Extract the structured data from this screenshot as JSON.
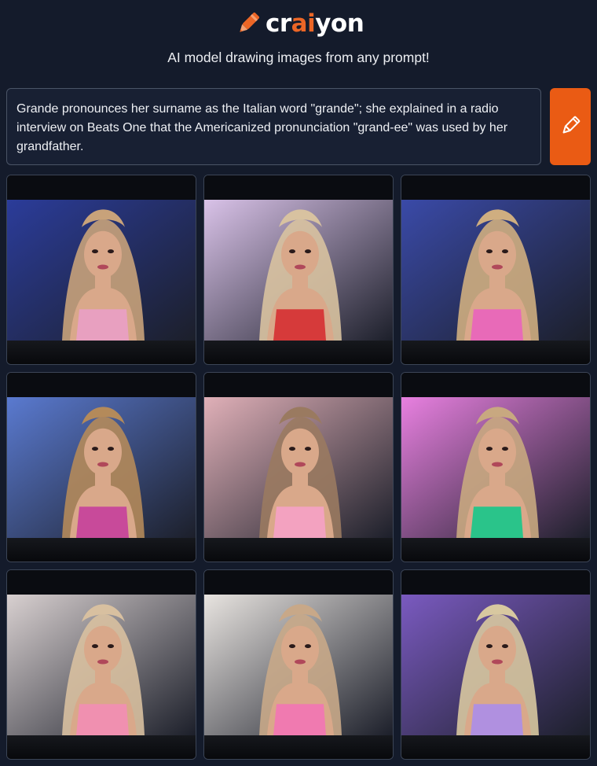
{
  "header": {
    "logo_prefix": "cr",
    "logo_ai": "ai",
    "logo_suffix": "yon",
    "tagline": "AI model drawing images from any prompt!",
    "accent_color": "#ec6626"
  },
  "prompt": {
    "text": "Grande pronounces her surname as the Italian word \"grande\"; she explained in a radio interview on Beats One that the Americanized pronunciation \"grand-ee\" was used by her grandfather.",
    "draw_button_icon": "pencil-icon"
  },
  "results": {
    "images": [
      {
        "bg": "#2b3c9a",
        "accent": "#e8a0c0",
        "hair": "#c8a27a"
      },
      {
        "bg": "#d9c2e8",
        "accent": "#d63a3a",
        "hair": "#d8c2a0"
      },
      {
        "bg": "#3a4aa8",
        "accent": "#e86ab8",
        "hair": "#cfae80"
      },
      {
        "bg": "#5a7ad0",
        "accent": "#c84a9a",
        "hair": "#b48a5a"
      },
      {
        "bg": "#e0b0b8",
        "accent": "#f3a2c0",
        "hair": "#9a7a60"
      },
      {
        "bg": "#e880e0",
        "accent": "#2ac48a",
        "hair": "#c8a880"
      },
      {
        "bg": "#d8d0d0",
        "accent": "#f090b0",
        "hair": "#d8c0a0"
      },
      {
        "bg": "#e8e4e0",
        "accent": "#f07ab0",
        "hair": "#c8a888"
      },
      {
        "bg": "#7a5ac0",
        "accent": "#b090e0",
        "hair": "#d8c8a0"
      }
    ]
  }
}
